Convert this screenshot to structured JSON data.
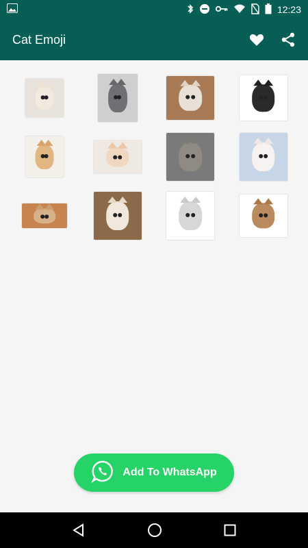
{
  "status_bar": {
    "time": "12:23",
    "icons": [
      "image-notification-icon",
      "bluetooth-icon",
      "do-not-disturb-icon",
      "vpn-key-icon",
      "wifi-icon",
      "no-sim-icon",
      "battery-icon"
    ]
  },
  "app_bar": {
    "title": "Cat Emoji",
    "actions": [
      "heart-icon",
      "share-icon"
    ]
  },
  "stickers": [
    {
      "name": "sticker-1",
      "bg": "#e8e2dc",
      "fur": "#f2e9df",
      "ear": "#efe3d5",
      "w": 56,
      "h": 56
    },
    {
      "name": "sticker-2",
      "bg": "#cfcfcf",
      "fur": "#6f7073",
      "ear": "#66676a",
      "w": 58,
      "h": 70
    },
    {
      "name": "sticker-3",
      "bg": "#a77a55",
      "fur": "#e9e0d6",
      "ear": "#dfd3c6",
      "w": 70,
      "h": 64
    },
    {
      "name": "sticker-4",
      "bg": "#ffffff",
      "fur": "#2b2b2b",
      "ear": "#1f1f1f",
      "w": 70,
      "h": 66
    },
    {
      "name": "sticker-5",
      "bg": "#f3efe9",
      "fur": "#e2b682",
      "ear": "#d9a56d",
      "w": 56,
      "h": 60
    },
    {
      "name": "sticker-6",
      "bg": "#efe9e4",
      "fur": "#f0d7c0",
      "ear": "#e9c7a8",
      "w": 70,
      "h": 48
    },
    {
      "name": "sticker-7",
      "bg": "#7a7a7a",
      "fur": "#8f8b84",
      "ear": "#807b74",
      "w": 70,
      "h": 70
    },
    {
      "name": "sticker-8",
      "bg": "#c7d6e7",
      "fur": "#f7f2f2",
      "ear": "#f1e6e6",
      "w": 70,
      "h": 70
    },
    {
      "name": "sticker-9",
      "bg": "#c7844e",
      "fur": "#d7b187",
      "ear": "#c89d70",
      "w": 66,
      "h": 36
    },
    {
      "name": "sticker-10",
      "bg": "#8b6a4a",
      "fur": "#f2e7dc",
      "ear": "#e8d8c6",
      "w": 70,
      "h": 70
    },
    {
      "name": "sticker-11",
      "bg": "#ffffff",
      "fur": "#d7d7d7",
      "ear": "#cacaca",
      "w": 70,
      "h": 70
    },
    {
      "name": "sticker-12",
      "bg": "#ffffff",
      "fur": "#b98b5e",
      "ear": "#ab7b4e",
      "w": 70,
      "h": 62
    }
  ],
  "cta": {
    "label": "Add To WhatsApp",
    "icon": "whatsapp-icon",
    "color": "#25d366"
  },
  "nav_bar": {
    "buttons": [
      "back-icon",
      "home-icon",
      "recents-icon"
    ]
  },
  "colors": {
    "primary": "#075e54",
    "accent": "#25d366"
  }
}
